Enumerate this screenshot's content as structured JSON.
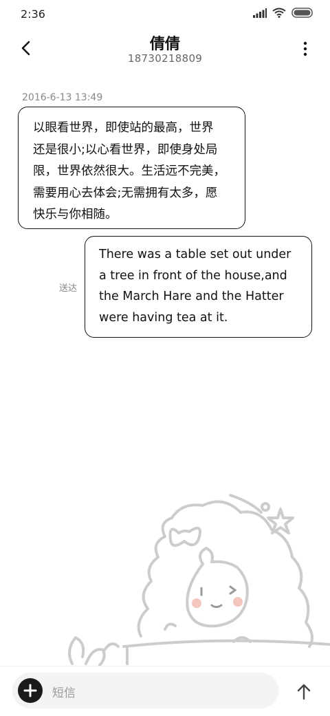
{
  "status_bar": {
    "time": "2:36",
    "icons": [
      "signal-icon",
      "wifi-icon",
      "battery-icon"
    ]
  },
  "header": {
    "contact_name": "倩倩",
    "phone_number": "18730218809",
    "back_icon": "chevron-left-icon",
    "more_icon": "more-vertical-icon"
  },
  "conversation": {
    "timestamp": "2016-6-13 13:49",
    "messages": [
      {
        "direction": "incoming",
        "lines": [
          "以眼看世界，即使站的最高，世界",
          "还是很小;以心看世界，即使身处局",
          "限，世界依然很大。生活远不完美，",
          "需要用心去体会;无需拥有太多，愿",
          "快乐与你相随。"
        ]
      },
      {
        "direction": "outgoing",
        "status": "送达",
        "lines": [
          "There was a table set out under",
          "a tree in front of the house,and",
          "the March Hare and the Hatter",
          "were having tea at it."
        ]
      }
    ]
  },
  "composer": {
    "placeholder": "短信",
    "add_icon": "plus-icon",
    "send_icon": "arrow-up-icon"
  },
  "colors": {
    "bubble_border": "#111111",
    "muted_text": "#888888",
    "input_bg": "#f3f3f3",
    "add_button_bg": "#1a1a1a",
    "wallpaper_stroke": "#cccccc"
  }
}
